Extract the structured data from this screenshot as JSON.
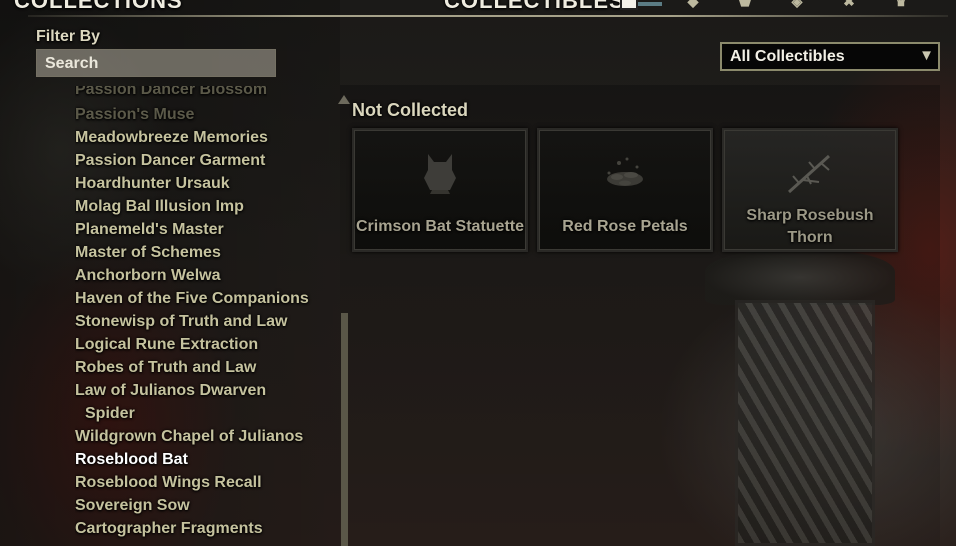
{
  "header": {
    "title": "COLLECTIONS",
    "tab_label": "COLLECTIBLES",
    "icons": [
      "square-tab-icon",
      "diamond-tab-icon",
      "shield-tab-icon",
      "wings-tab-icon",
      "crossed-tab-icon",
      "crown-tab-icon"
    ]
  },
  "filter": {
    "label": "Filter By",
    "search_placeholder": "Search"
  },
  "list": {
    "items": [
      {
        "label": "Passion Dancer Blossom",
        "state": "faded"
      },
      {
        "label": "Passion's Muse",
        "state": "faded"
      },
      {
        "label": "Meadowbreeze Memories",
        "state": "normal"
      },
      {
        "label": "Passion Dancer Garment",
        "state": "normal"
      },
      {
        "label": "Hoardhunter Ursauk",
        "state": "normal"
      },
      {
        "label": "Molag Bal Illusion Imp",
        "state": "normal"
      },
      {
        "label": "Planemeld's Master",
        "state": "normal"
      },
      {
        "label": "Master of Schemes",
        "state": "normal"
      },
      {
        "label": "Anchorborn Welwa",
        "state": "normal"
      },
      {
        "label": "Haven of the Five Companions",
        "state": "normal"
      },
      {
        "label": "Stonewisp of Truth and Law",
        "state": "normal"
      },
      {
        "label": "Logical Rune Extraction",
        "state": "normal"
      },
      {
        "label": "Robes of Truth and Law",
        "state": "normal"
      },
      {
        "label": "Law of Julianos Dwarven",
        "state": "normal"
      },
      {
        "label": "Spider",
        "state": "normal"
      },
      {
        "label": "Wildgrown Chapel of Julianos",
        "state": "normal"
      },
      {
        "label": "Roseblood Bat",
        "state": "selected"
      },
      {
        "label": "Roseblood Wings Recall",
        "state": "normal"
      },
      {
        "label": "Sovereign Sow",
        "state": "normal"
      },
      {
        "label": "Cartographer Fragments",
        "state": "normal"
      }
    ]
  },
  "dropdown": {
    "selected": "All Collectibles"
  },
  "main": {
    "section_header": "Not Collected",
    "tiles": [
      {
        "name": "Crimson Bat Statuette",
        "icon": "bat-statuette-icon"
      },
      {
        "name": "Red Rose Petals",
        "icon": "rose-petals-icon"
      },
      {
        "name": "Sharp Rosebush Thorn",
        "icon": "thorn-branch-icon"
      }
    ]
  },
  "colors": {
    "text": "#c5c29e",
    "selected_text": "#ffffff",
    "dropdown_border": "#8b8a6c"
  }
}
